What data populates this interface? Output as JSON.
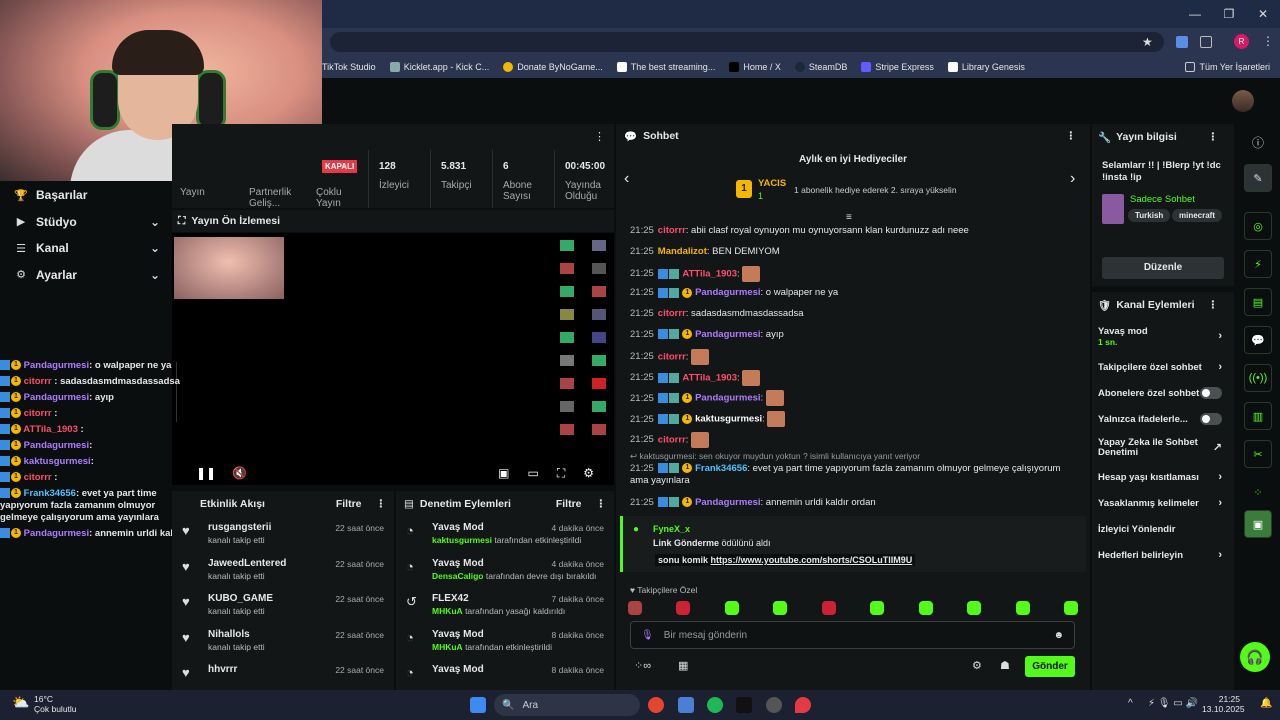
{
  "bookmarks": [
    "TikTok Studio",
    "Kicklet.app - Kick C...",
    "Donate ByNoGame...",
    "The best streaming...",
    "Home / X",
    "SteamDB",
    "Stripe Express",
    "Library Genesis"
  ],
  "bookmarks_right": "Tüm Yer İşaretleri",
  "profile_letter": "R",
  "nav": [
    {
      "label": "Başarılar",
      "icon": "trophy-icon",
      "chev": false
    },
    {
      "label": "Stüdyo",
      "icon": "studio-icon",
      "chev": true
    },
    {
      "label": "Kanal",
      "icon": "channel-icon",
      "chev": true
    },
    {
      "label": "Ayarlar",
      "icon": "gear-icon",
      "chev": true
    }
  ],
  "overlay_chat": [
    {
      "user": "Pandagurmesi",
      "color": "#b07cff",
      "text": ": o walpaper ne ya"
    },
    {
      "user": "citorrr",
      "color": "#ff4d6d",
      "text": " : sadasdasmdmasdassadsa"
    },
    {
      "user": "Pandagurmesi",
      "color": "#b07cff",
      "text": ": ayıp"
    },
    {
      "user": "citorrr",
      "color": "#ff4d6d",
      "text": " :"
    },
    {
      "user": "ATTila_1903",
      "color": "#ff4d6d",
      "text": " :"
    },
    {
      "user": "Pandagurmesi",
      "color": "#b07cff",
      "text": ":"
    },
    {
      "user": "kaktusgurmesi",
      "color": "#b07cff",
      "text": ":"
    },
    {
      "user": "citorrr",
      "color": "#ff4d6d",
      "text": " :"
    },
    {
      "user": "Frank34656",
      "color": "#4fc3ff",
      "text": ": evet ya part time yapıyorum fazla zamanım olmuyor gelmeye çalışıyorum ama yayınlara"
    },
    {
      "user": "Pandagurmesi",
      "color": "#b07cff",
      "text": ": annemin urldi kaldır ordan"
    }
  ],
  "stats": {
    "status": "KAPALI",
    "top_labels": [
      "Yayın",
      "Partnerlik Geliş...",
      "Çoklu Yayın"
    ],
    "items": [
      {
        "value": "128",
        "label": "İzleyici"
      },
      {
        "value": "5.831",
        "label": "Takipçi"
      },
      {
        "value": "6",
        "label": "Abone Sayısı"
      },
      {
        "value": "00:45:00",
        "label": "Yayında Olduğu"
      }
    ]
  },
  "preview": {
    "title": "Yayın Ön İzlemesi"
  },
  "activity": {
    "title": "Etkinlik Akışı",
    "filter": "Filtre",
    "rows": [
      {
        "name": "rusgangsterii",
        "sub": "kanalı takip etti",
        "time": "22 saat önce"
      },
      {
        "name": "JaweedLentered",
        "sub": "kanalı takip etti",
        "time": "22 saat önce"
      },
      {
        "name": "KUBO_GAME",
        "sub": "kanalı takip etti",
        "time": "22 saat önce"
      },
      {
        "name": "Nihallols",
        "sub": "kanalı takip etti",
        "time": "22 saat önce"
      },
      {
        "name": "hhvrrr",
        "sub": "",
        "time": "22 saat önce"
      }
    ]
  },
  "moderation": {
    "title": "Denetim Eylemleri",
    "filter": "Filtre",
    "rows": [
      {
        "name": "Yavaş Mod",
        "actor": "kaktusgurmesi",
        "sub": " tarafından etkinleştirildi",
        "time": "4 dakika önce",
        "icon": "slow-mode-icon"
      },
      {
        "name": "Yavaş Mod",
        "actor": "DensaCaligo",
        "sub": " tarafından devre dışı bırakıldı",
        "time": "4 dakika önce",
        "icon": "slow-mode-icon"
      },
      {
        "name": "FLEX42",
        "actor": "MHKuA",
        "sub": " tarafından yasağı kaldırıldı",
        "time": "7 dakika önce",
        "icon": "unban-icon"
      },
      {
        "name": "Yavaş Mod",
        "actor": "MHKuA",
        "sub": " tarafından etkinleştirildi",
        "time": "8 dakika önce",
        "icon": "slow-mode-icon"
      },
      {
        "name": "Yavaş Mod",
        "actor": "",
        "sub": "",
        "time": "8 dakika önce",
        "icon": "slow-mode-icon"
      }
    ]
  },
  "chat": {
    "title": "Sohbet",
    "gifters_title": "Aylık en iyi Hediyeciler",
    "gifter_name": "YACIS",
    "gifter_count": "1",
    "gifter_note": "1 abonelik hediye ederek 2. sıraya yükselin",
    "messages": [
      {
        "time": "21:25",
        "user": "citorrr",
        "color": "#ff4d6d",
        "text": ": abii clasf royal oynuyon mu oynuyorsann klan kurdunuzz adı neee",
        "badges": 0,
        "emote": false
      },
      {
        "time": "21:25",
        "user": "Mandalizot",
        "color": "#f5b700",
        "text": ": BEN DEMIYOM",
        "badges": 0,
        "emote": false
      },
      {
        "time": "21:25",
        "user": "ATTila_1903",
        "color": "#ff4d6d",
        "text": ":",
        "badges": 2,
        "emote": true
      },
      {
        "time": "21:25",
        "user": "Pandagurmesi",
        "color": "#b07cff",
        "text": ": o walpaper ne ya",
        "badges": 3,
        "emote": false
      },
      {
        "time": "21:25",
        "user": "citorrr",
        "color": "#ff4d6d",
        "text": ": sadasdasmdmasdassadsa",
        "badges": 0,
        "emote": false
      },
      {
        "time": "21:25",
        "user": "Pandagurmesi",
        "color": "#b07cff",
        "text": ": ayıp",
        "badges": 3,
        "emote": false
      },
      {
        "time": "21:25",
        "user": "citorrr",
        "color": "#ff4d6d",
        "text": ":",
        "badges": 0,
        "emote": true
      },
      {
        "time": "21:25",
        "user": "ATTila_1903",
        "color": "#ff4d6d",
        "text": ":",
        "badges": 2,
        "emote": true
      },
      {
        "time": "21:25",
        "user": "Pandagurmesi",
        "color": "#b07cff",
        "text": ":",
        "badges": 3,
        "emote": true
      },
      {
        "time": "21:25",
        "user": "kaktusgurmesi",
        "color": "#ffffff",
        "text": ":",
        "badges": 3,
        "emote": true
      },
      {
        "time": "21:25",
        "user": "citorrr",
        "color": "#ff4d6d",
        "text": ":",
        "badges": 0,
        "emote": true
      }
    ],
    "reply_context": "kaktusgurmesi: sen okuyor muydun yoktun ? isimli kullanıcıya yanıt veriyor",
    "frank_time": "21:25",
    "frank_user": "Frank34656",
    "frank_text": ": evet ya part time yapıyorum fazla zamanım olmuyor gelmeye çalışıyorum ama yayınlara",
    "last_time": "21:25",
    "last_user": "Pandagurmesi",
    "last_text": ": annemin urldi kaldır ordan",
    "reward_user": "FyneX_x",
    "reward_title": "Link Gönderme",
    "reward_suffix": " ödülünü aldı",
    "reward_label": "sonu komik",
    "reward_link": "https://www.youtube.com/shorts/CSOLuTlIM9U",
    "follower_only": "Takipçilere Özel",
    "input_placeholder": "Bir mesaj gönderin",
    "send": "Gönder"
  },
  "info": {
    "title": "Yayın bilgisi",
    "stream_title": "Selamlarr !! | !Blerp !yt !dc !insta !ip",
    "category": "Sadece Sohbet",
    "tags": [
      "Turkish",
      "minecraft"
    ],
    "edit": "Düzenle"
  },
  "channel_actions": {
    "title": "Kanal Eylemleri",
    "slow_mode": "Yavaş mod",
    "slow_value": "1 sn.",
    "items": [
      {
        "label": "Takipçilere özel sohbet",
        "type": "chev"
      },
      {
        "label": "Abonelere özel sohbet",
        "type": "toggle"
      },
      {
        "label": "Yalnızca ifadelerle...",
        "type": "toggle"
      },
      {
        "label": "Yapay Zeka ile Sohbet Denetimi",
        "type": "ext"
      },
      {
        "label": "Hesap yaşı kısıtlaması",
        "type": "chev"
      },
      {
        "label": "Yasaklanmış kelimeler",
        "type": "chev"
      },
      {
        "label": "İzleyici Yönlendir",
        "type": "none"
      },
      {
        "label": "Hedefleri belirleyin",
        "type": "chev"
      }
    ]
  },
  "taskbar": {
    "temp": "16°C",
    "weather": "Çok bulutlu",
    "search": "Ara",
    "time": "21:25",
    "date": "13.10.2025"
  },
  "colors": {
    "accent": "#53fc18",
    "bg": "#0b0e0f",
    "panel": "#131617"
  }
}
